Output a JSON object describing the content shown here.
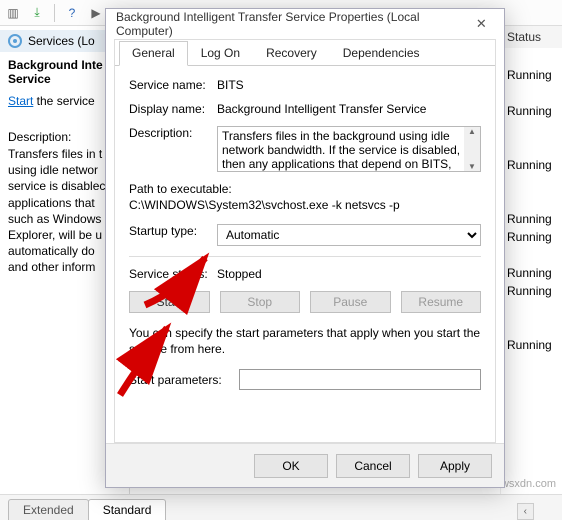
{
  "toolbar": {
    "icons": [
      "doc",
      "export",
      "help",
      "go",
      "stop",
      "pause",
      "refresh"
    ]
  },
  "services_panel": {
    "header": "Services (Lo",
    "selected_service": "Background Inte\nService",
    "start_link": "Start",
    "start_suffix": " the service",
    "description_label": "Description:",
    "description_text": "Transfers files in t\nusing idle networ\nservice is disablec\napplications that\nsuch as Windows\nExplorer, will be u\nautomatically do\nand other inform"
  },
  "status_column": {
    "header": "Status",
    "rows": [
      "",
      "Running",
      "",
      "Running",
      "",
      "",
      "Running",
      "",
      "",
      "Running",
      "Running",
      "",
      "Running",
      "Running",
      "",
      "",
      "Running"
    ]
  },
  "bottom_tabs": {
    "extended": "Extended",
    "standard": "Standard"
  },
  "dialog": {
    "title": "Background Intelligent Transfer Service Properties (Local Computer)",
    "tabs": {
      "general": "General",
      "logon": "Log On",
      "recovery": "Recovery",
      "deps": "Dependencies"
    },
    "labels": {
      "service_name": "Service name:",
      "display_name": "Display name:",
      "description": "Description:",
      "path_label": "Path to executable:",
      "startup_type": "Startup type:",
      "service_status": "Service status:",
      "hint": "You can specify the start parameters that apply when you start the service from here.",
      "start_params": "Start parameters:"
    },
    "values": {
      "service_name": "BITS",
      "display_name": "Background Intelligent Transfer Service",
      "description": "Transfers files in the background using idle network bandwidth. If the service is disabled, then any applications that depend on BITS, such as Windows",
      "path": "C:\\WINDOWS\\System32\\svchost.exe -k netsvcs -p",
      "startup_type": "Automatic",
      "service_status": "Stopped",
      "start_params": ""
    },
    "buttons": {
      "start": "Start",
      "stop": "Stop",
      "pause": "Pause",
      "resume": "Resume",
      "ok": "OK",
      "cancel": "Cancel",
      "apply": "Apply"
    }
  },
  "watermark": "wsxdn.com"
}
